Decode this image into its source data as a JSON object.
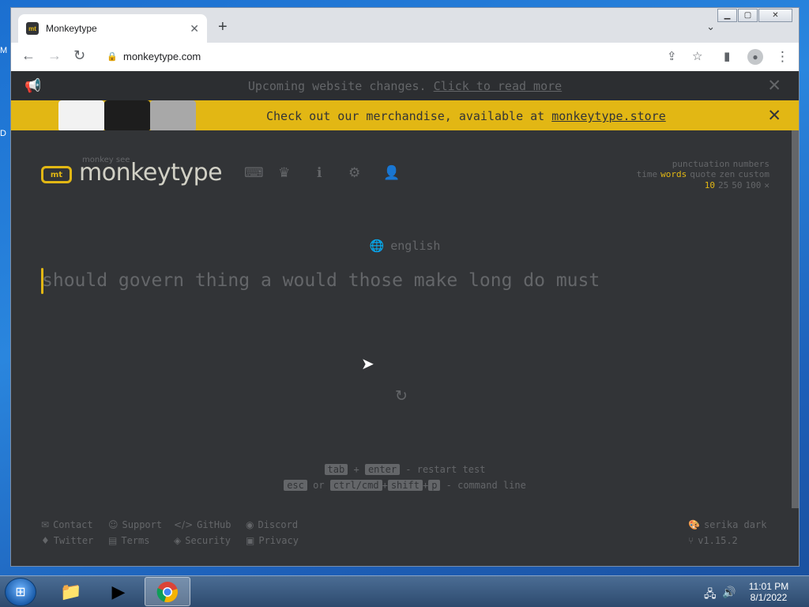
{
  "desktop": {
    "edge_top": "M",
    "edge_mid": "D"
  },
  "window": {
    "minimize": "▁",
    "maximize": "▢",
    "close": "✕"
  },
  "browser": {
    "tab_title": "Monkeytype",
    "tab_close": "✕",
    "new_tab": "+",
    "tab_dropdown": "⌄",
    "back": "←",
    "forward": "→",
    "reload": "↻",
    "lock": "🔒",
    "url": "monkeytype.com",
    "share": "⇪",
    "star": "☆",
    "sidepanel": "▮",
    "menu": "⋮"
  },
  "banners": {
    "notice_text": "Upcoming website changes. ",
    "notice_link": "Click to read more",
    "merch_text": "Check out our merchandise, available at ",
    "merch_link": "monkeytype.store",
    "close": "✕"
  },
  "logo": {
    "icon": "mt",
    "top": "monkey see",
    "name": "monkeytype"
  },
  "nav_icons": [
    "keyboard-icon",
    "crown-icon",
    "info-icon",
    "gear-icon",
    "user-icon"
  ],
  "config": {
    "row1": [
      "punctuation",
      "numbers"
    ],
    "row2": [
      "time",
      "words",
      "quote",
      "zen",
      "custom"
    ],
    "row3": [
      "10",
      "25",
      "50",
      "100",
      "✕"
    ],
    "active_mode": "words",
    "active_count": "10"
  },
  "test": {
    "language": "english",
    "words": "should govern thing a would those make long do must"
  },
  "hints": {
    "tab": "tab",
    "plus": "+",
    "enter": "enter",
    "restart": " - restart test",
    "esc": "esc",
    "or": "or",
    "ctrl": "ctrl/cmd",
    "shift": "shift",
    "p": "p",
    "command": " - command line"
  },
  "footer": {
    "links_left": [
      {
        "icon": "✉",
        "label": "Contact"
      },
      {
        "icon": "☺",
        "label": "Support"
      },
      {
        "icon": "</>",
        "label": "GitHub"
      },
      {
        "icon": "◉",
        "label": "Discord"
      },
      {
        "icon": "♦",
        "label": "Twitter"
      },
      {
        "icon": "▤",
        "label": "Terms"
      },
      {
        "icon": "◈",
        "label": "Security"
      },
      {
        "icon": "▣",
        "label": "Privacy"
      }
    ],
    "theme": "serika dark",
    "version": "v1.15.2"
  },
  "taskbar": {
    "clock_time": "11:01 PM",
    "clock_date": "8/1/2022"
  },
  "colors": {
    "bg": "#323437",
    "main": "#e2b714",
    "sub": "#646669",
    "text": "#d1d0c5"
  }
}
